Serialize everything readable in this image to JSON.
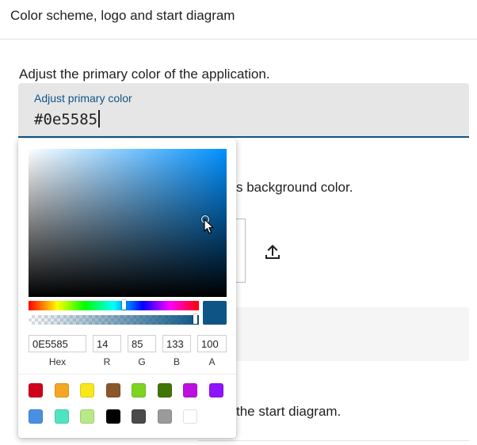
{
  "header": {
    "title": "Color scheme, logo and start diagram"
  },
  "sections": {
    "primary_color_text": "Adjust the primary color of the application.",
    "background_color_text_partial": "s background color.",
    "start_diagram_text_partial": "the start diagram."
  },
  "primary_color_field": {
    "label": "Adjust primary color",
    "value": "#0e5585"
  },
  "icons": {
    "upload": "upload-icon",
    "cursor": "mouse-pointer-icon"
  },
  "color_picker": {
    "current_color": "#0e5585",
    "hue_color": "#0090ff",
    "hex": "0E5585",
    "r": "14",
    "g": "85",
    "b": "133",
    "a": "100",
    "labels": {
      "hex": "Hex",
      "r": "R",
      "g": "G",
      "b": "B",
      "a": "A"
    },
    "preset_swatches": [
      "#d0021b",
      "#f5a623",
      "#f8e71c",
      "#8b572a",
      "#7ed321",
      "#417505",
      "#bd10e0",
      "#9013fe",
      "#4a90e2",
      "#50e3c2",
      "#b8e986",
      "#000000",
      "#4a4a4a",
      "#9b9b9b",
      "#ffffff"
    ]
  }
}
